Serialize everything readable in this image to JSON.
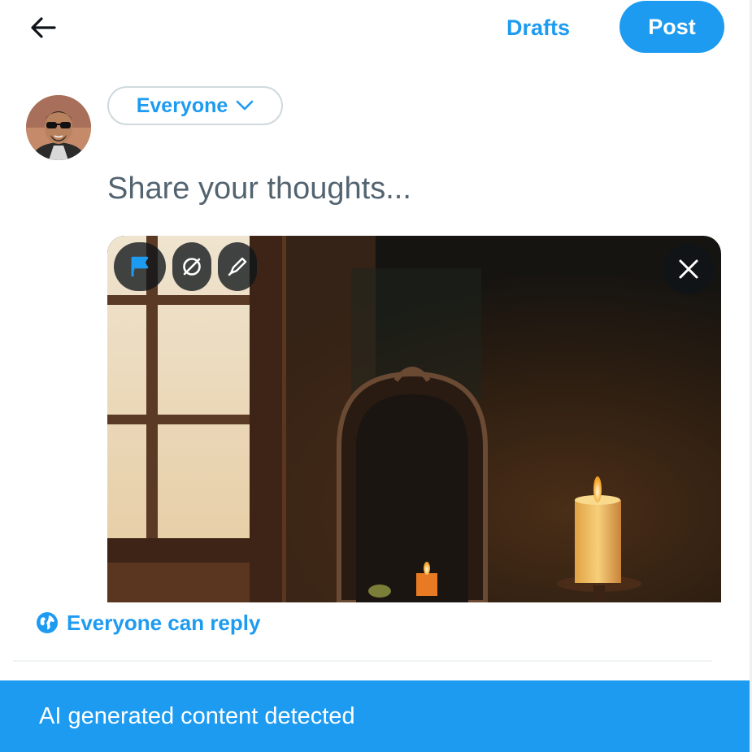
{
  "header": {
    "back_icon": "arrow-left-icon",
    "drafts_label": "Drafts",
    "post_label": "Post"
  },
  "audience": {
    "label": "Everyone",
    "icon": "chevron-down-icon"
  },
  "composer": {
    "placeholder": "Share your thoughts..."
  },
  "media": {
    "tools": [
      "flag-icon",
      "alt-text-icon",
      "edit-icon"
    ],
    "close_icon": "close-icon"
  },
  "reply_setting": {
    "icon": "globe-icon",
    "label": "Everyone can reply"
  },
  "banner": {
    "text": "AI generated content detected"
  },
  "colors": {
    "accent": "#1d9bf0",
    "text_muted": "#536471",
    "border": "#cfd9de"
  }
}
